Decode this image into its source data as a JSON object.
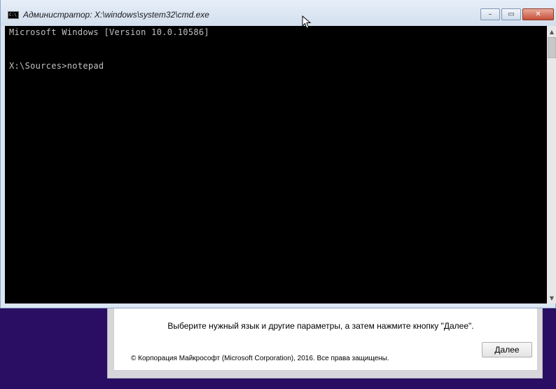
{
  "setup": {
    "instruction": "Выберите нужный язык и другие параметры, а затем нажмите кнопку \"Далее\".",
    "copyright": "© Корпорация Майкрософт (Microsoft Corporation), 2016. Все права защищены.",
    "next_label": "Далее"
  },
  "cmd": {
    "title": "Администратор: X:\\windows\\system32\\cmd.exe",
    "icon": "C:\\",
    "lines": [
      "Microsoft Windows [Version 10.0.10586]",
      "X:\\Sources>notepad"
    ],
    "buttons": {
      "minimize": "–",
      "maximize": "▭",
      "close": "✕"
    },
    "scroll": {
      "up": "▲",
      "down": "▼"
    }
  },
  "colors": {
    "desktop_bg": "#2a0e63",
    "console_bg": "#000000",
    "console_text": "#c0c0c0"
  }
}
